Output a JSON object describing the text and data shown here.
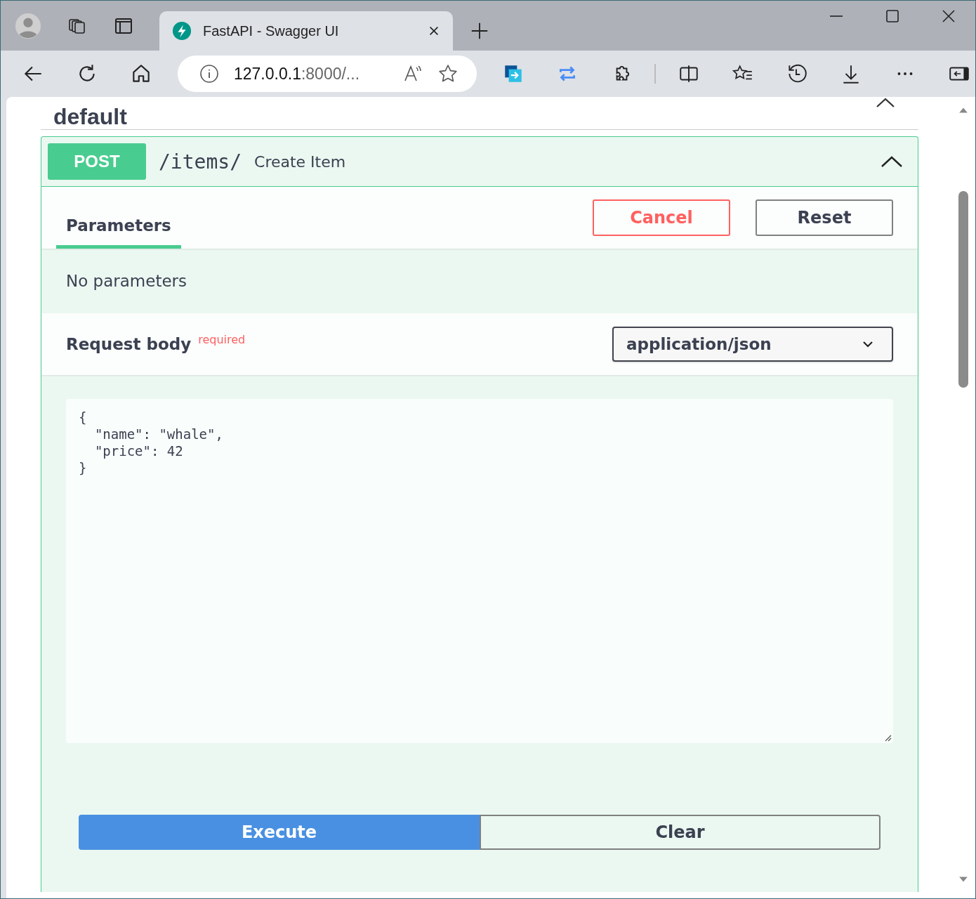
{
  "browser": {
    "tab": {
      "title": "FastAPI - Swagger UI",
      "selected": true
    },
    "address": {
      "host": "127.0.0.1",
      "rest": ":8000/..."
    }
  },
  "section": {
    "title": "default",
    "expanded": true
  },
  "operation": {
    "method": "POST",
    "path": "/items/",
    "summary": "Create Item",
    "expanded": true,
    "tabs": [
      {
        "label": "Parameters",
        "selected": true
      }
    ],
    "buttons": {
      "cancel": "Cancel",
      "reset": "Reset"
    },
    "parameters_note": "No parameters",
    "request_body": {
      "title": "Request body",
      "required_label": "required",
      "content_type": "application/json",
      "lines": [
        "{",
        "  \"name\": \"whale\",",
        "  \"price\": 42",
        "}"
      ]
    },
    "actions": {
      "execute": "Execute",
      "clear": "Clear"
    }
  }
}
